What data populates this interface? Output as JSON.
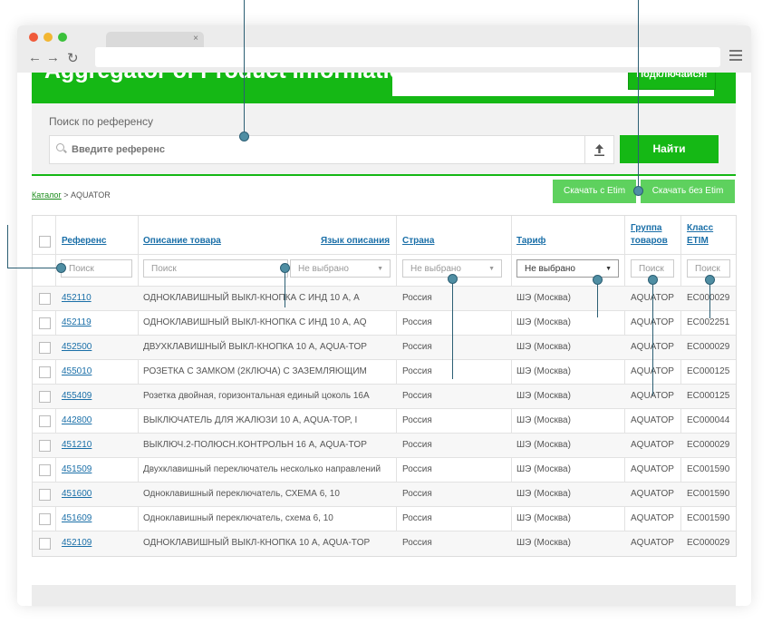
{
  "banner": {
    "title": "Aggregator of Product Information",
    "connect_label": "Подключайся!"
  },
  "search": {
    "label": "Поиск по референсу",
    "placeholder": "Введите референс",
    "find_label": "Найти"
  },
  "breadcrumb": {
    "root": "Каталог",
    "separator": ">",
    "current": "AQUATOR"
  },
  "downloads": {
    "with_etim": "Скачать с Etim",
    "without_etim": "Скачать без Etim"
  },
  "table": {
    "columns": {
      "reference": "Референс",
      "description": "Описание товара",
      "language": "Язык описания",
      "country": "Страна",
      "tariff": "Тариф",
      "group_line1": "Группа",
      "group_line2": "товаров",
      "class_line1": "Класс",
      "class_line2": "ETIM"
    },
    "filters": {
      "reference_placeholder": "Поиск",
      "description_placeholder": "Поиск",
      "language_value": "Не выбрано",
      "country_value": "Не выбрано",
      "tariff_value": "Не выбрано",
      "group_placeholder": "Поиск",
      "class_placeholder": "Поиск"
    },
    "rows": [
      {
        "ref": "452110",
        "desc": "ОДНОКЛАВИШНЫЙ ВЫКЛ-КНОПКА С ИНД 10 А, А",
        "country": "Россия",
        "tariff": "ШЭ (Москва)",
        "group": "AQUATOP",
        "etim": "EC000029"
      },
      {
        "ref": "452119",
        "desc": "ОДНОКЛАВИШНЫЙ ВЫКЛ-КНОПКА С ИНД 10 А, AQ",
        "country": "Россия",
        "tariff": "ШЭ (Москва)",
        "group": "AQUATOP",
        "etim": "EC002251"
      },
      {
        "ref": "452500",
        "desc": "ДВУХКЛАВИШНЫЙ ВЫКЛ-КНОПКА 10 А, AQUA-TOP",
        "country": "Россия",
        "tariff": "ШЭ (Москва)",
        "group": "AQUATOP",
        "etim": "EC000029"
      },
      {
        "ref": "455010",
        "desc": "РОЗЕТКА С ЗАМКОМ (2КЛЮЧА) С ЗАЗЕМЛЯЮЩИМ",
        "country": "Россия",
        "tariff": "ШЭ (Москва)",
        "group": "AQUATOP",
        "etim": "EC000125"
      },
      {
        "ref": "455409",
        "desc": "Розетка двойная, горизонтальная единый цоколь 16А",
        "country": "Россия",
        "tariff": "ШЭ (Москва)",
        "group": "AQUATOP",
        "etim": "EC000125"
      },
      {
        "ref": "442800",
        "desc": "ВЫКЛЮЧАТЕЛЬ ДЛЯ ЖАЛЮЗИ 10 А, AQUA-TOP, I",
        "country": "Россия",
        "tariff": "ШЭ (Москва)",
        "group": "AQUATOP",
        "etim": "EC000044"
      },
      {
        "ref": "451210",
        "desc": "ВЫКЛЮЧ.2-ПОЛЮСН.КОНТРОЛЬН 16 А, AQUA-TOP",
        "country": "Россия",
        "tariff": "ШЭ (Москва)",
        "group": "AQUATOP",
        "etim": "EC000029"
      },
      {
        "ref": "451509",
        "desc": "Двухклавишный переключатель несколько направлений",
        "country": "Россия",
        "tariff": "ШЭ (Москва)",
        "group": "AQUATOP",
        "etim": "EC001590"
      },
      {
        "ref": "451600",
        "desc": "Одноклавишный переключатель, СХЕМА 6, 10",
        "country": "Россия",
        "tariff": "ШЭ (Москва)",
        "group": "AQUATOP",
        "etim": "EC001590"
      },
      {
        "ref": "451609",
        "desc": "Одноклавишный переключатель, схема 6, 10",
        "country": "Россия",
        "tariff": "ШЭ (Москва)",
        "group": "AQUATOP",
        "etim": "EC001590"
      },
      {
        "ref": "452109",
        "desc": "ОДНОКЛАВИШНЫЙ ВЫКЛ-КНОПКА 10 А, AQUA-TOP",
        "country": "Россия",
        "tariff": "ШЭ (Москва)",
        "group": "AQUATOP",
        "etim": "EC000029"
      }
    ]
  },
  "colors": {
    "accent": "#15b815",
    "accent_light": "#5ed15e",
    "link": "#1a6fa8",
    "annotation": "#2c5f74"
  }
}
